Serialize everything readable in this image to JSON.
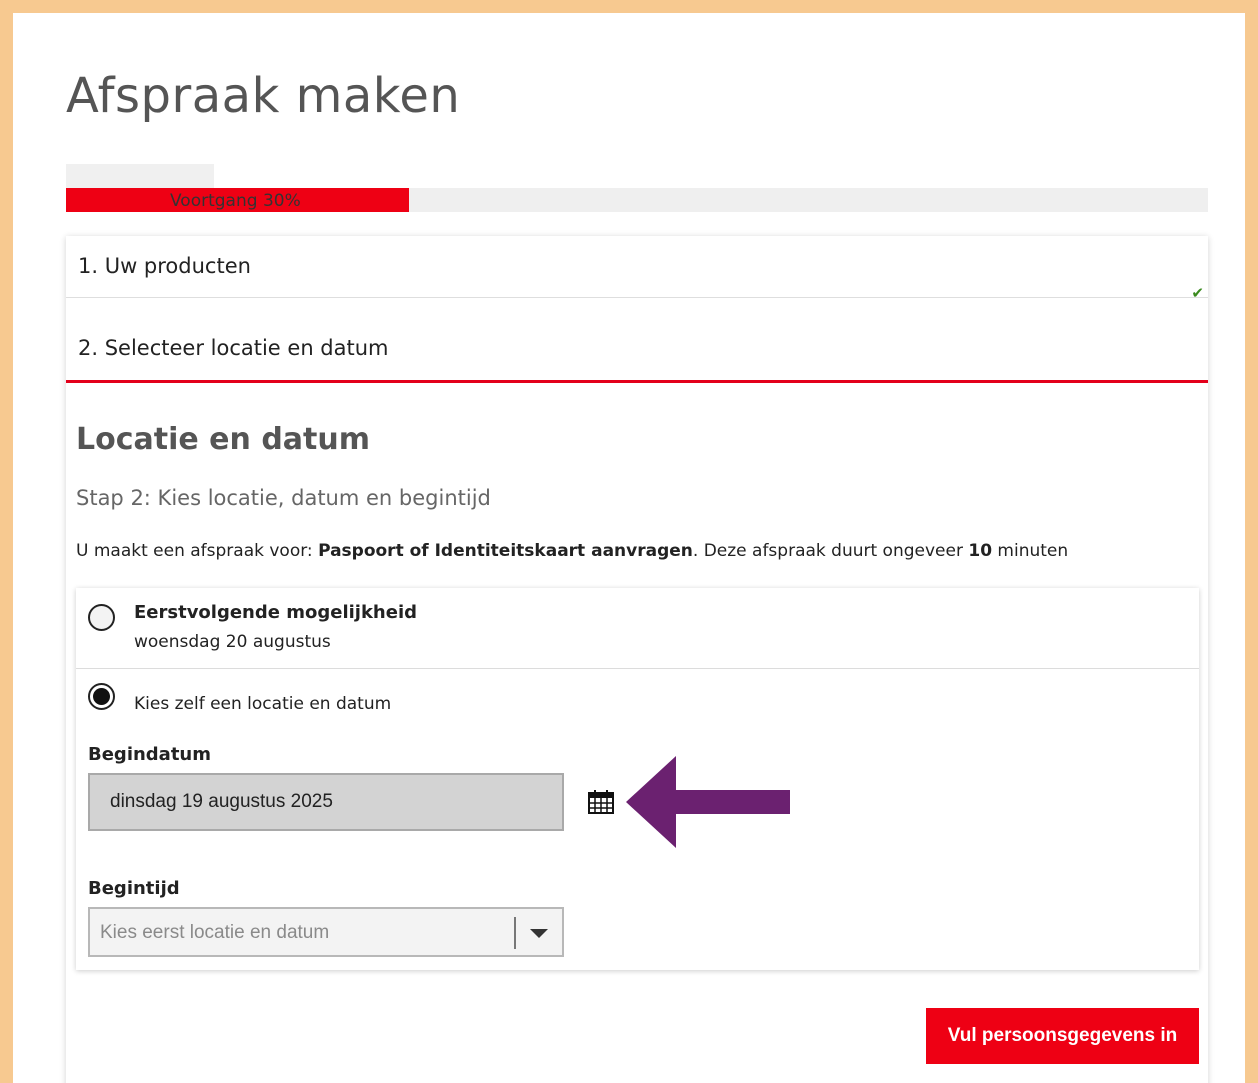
{
  "page": {
    "title": "Afspraak maken"
  },
  "progress": {
    "label": "Voortgang 30%",
    "percent": 30
  },
  "steps": [
    {
      "label": "1. Uw producten",
      "completed": true,
      "icon": "check-icon"
    },
    {
      "label": "2. Selecteer locatie en datum",
      "active": true
    }
  ],
  "section": {
    "title": "Locatie en datum",
    "subtitle": "Stap 2: Kies locatie, datum en begintijd",
    "intro_prefix": "U maakt een afspraak voor: ",
    "product": "Paspoort of Identiteitskaart aanvragen",
    "intro_middle": ". Deze afspraak duurt ongeveer ",
    "duration": "10",
    "intro_suffix": " minuten"
  },
  "options": {
    "first": {
      "title": "Eerstvolgende mogelijkheid",
      "date": "woensdag 20 augustus",
      "selected": false
    },
    "custom": {
      "label": "Kies zelf een locatie en datum",
      "selected": true,
      "begindatum_label": "Begindatum",
      "begindatum_value": "dinsdag 19 augustus 2025",
      "calendar_icon": "calendar-icon",
      "begintijd_label": "Begintijd",
      "begintijd_placeholder": "Kies eerst locatie en datum"
    }
  },
  "actions": {
    "submit_label": "Vul persoonsgegevens in"
  },
  "colors": {
    "accent": "#ee0014",
    "frame": "#f7c990",
    "annotation_arrow": "#6b2170",
    "check": "#3a8a1e"
  }
}
